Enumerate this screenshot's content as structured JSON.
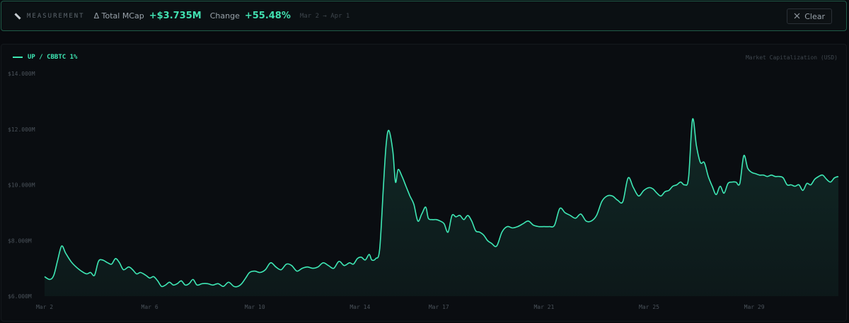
{
  "measurement": {
    "label": "MEASUREMENT",
    "icon": "ruler-icon",
    "delta_label": "Δ Total MCap",
    "delta_value": "+$3.735M",
    "change_label": "Change",
    "change_value": "+55.48%",
    "range": "Mar 2 → Apr 1",
    "clear_label": "Clear",
    "clear_icon": "close-icon"
  },
  "colors": {
    "accent": "#3ee8b5",
    "background": "#080a0e",
    "panel_border": "#1f5a47"
  },
  "chart_data": {
    "type": "area",
    "legend": "UP / CBBTC 1%",
    "ylabel": "Market Capitalization (USD)",
    "ylim": [
      6.0,
      14.0
    ],
    "y_ticks": [
      "$6.000M",
      "$8.000M",
      "$10.000M",
      "$12.000M",
      "$14.000M"
    ],
    "y_tick_values": [
      6,
      8,
      10,
      12,
      14
    ],
    "x_ticks": [
      "Mar 2",
      "Mar 6",
      "Mar 10",
      "Mar 14",
      "Mar 17",
      "Mar 21",
      "Mar 25",
      "Mar 29"
    ],
    "x_tick_days": [
      0,
      4,
      8,
      12,
      15,
      19,
      23,
      27
    ],
    "xlim_days": [
      0,
      30.2
    ],
    "grid": false,
    "series": [
      {
        "name": "UP / CBBTC 1%",
        "x_days": [
          0,
          0.2,
          0.35,
          0.5,
          0.65,
          0.8,
          1.0,
          1.2,
          1.4,
          1.6,
          1.75,
          1.9,
          2.05,
          2.2,
          2.4,
          2.55,
          2.7,
          2.85,
          3.0,
          3.2,
          3.35,
          3.5,
          3.65,
          3.85,
          4.0,
          4.15,
          4.3,
          4.45,
          4.6,
          4.75,
          4.9,
          5.05,
          5.2,
          5.35,
          5.5,
          5.65,
          5.8,
          6.0,
          6.2,
          6.4,
          6.6,
          6.8,
          7.0,
          7.2,
          7.35,
          7.5,
          7.65,
          7.8,
          8.0,
          8.2,
          8.4,
          8.6,
          8.8,
          9.0,
          9.2,
          9.4,
          9.6,
          9.8,
          10.0,
          10.2,
          10.4,
          10.6,
          10.8,
          11.0,
          11.2,
          11.4,
          11.6,
          11.75,
          11.9,
          12.05,
          12.2,
          12.35,
          12.45,
          12.6,
          12.75,
          12.9,
          13.0,
          13.1,
          13.25,
          13.35,
          13.45,
          13.6,
          13.75,
          13.9,
          14.05,
          14.2,
          14.35,
          14.5,
          14.6,
          14.75,
          14.9,
          15.05,
          15.2,
          15.35,
          15.5,
          15.65,
          15.8,
          15.95,
          16.1,
          16.25,
          16.4,
          16.55,
          16.7,
          16.85,
          17.0,
          17.2,
          17.4,
          17.6,
          17.8,
          18.0,
          18.2,
          18.4,
          18.6,
          18.8,
          19.0,
          19.2,
          19.4,
          19.6,
          19.8,
          20.0,
          20.2,
          20.4,
          20.6,
          20.8,
          21.0,
          21.2,
          21.4,
          21.6,
          21.8,
          22.0,
          22.2,
          22.4,
          22.6,
          22.8,
          23.0,
          23.15,
          23.3,
          23.45,
          23.6,
          23.75,
          23.9,
          24.05,
          24.2,
          24.35,
          24.5,
          24.65,
          24.8,
          24.95,
          25.1,
          25.25,
          25.4,
          25.55,
          25.7,
          25.85,
          26.0,
          26.15,
          26.3,
          26.45,
          26.6,
          26.75,
          26.9,
          27.05,
          27.2,
          27.35,
          27.5,
          27.65,
          27.8,
          27.95,
          28.1,
          28.25,
          28.4,
          28.55,
          28.7,
          28.85,
          29.0,
          29.15,
          29.3,
          29.45,
          29.6,
          29.75,
          29.9,
          30.05,
          30.2
        ],
        "values_musd": [
          6.7,
          6.6,
          6.75,
          7.3,
          7.8,
          7.55,
          7.25,
          7.05,
          6.9,
          6.8,
          6.85,
          6.75,
          7.25,
          7.3,
          7.2,
          7.15,
          7.35,
          7.2,
          6.95,
          7.05,
          6.95,
          6.8,
          6.85,
          6.75,
          6.65,
          6.7,
          6.55,
          6.35,
          6.4,
          6.5,
          6.4,
          6.45,
          6.55,
          6.4,
          6.45,
          6.6,
          6.4,
          6.45,
          6.45,
          6.4,
          6.45,
          6.35,
          6.5,
          6.35,
          6.35,
          6.45,
          6.65,
          6.85,
          6.9,
          6.85,
          6.95,
          7.2,
          7.05,
          6.95,
          7.15,
          7.1,
          6.9,
          7.0,
          7.05,
          7.0,
          7.05,
          7.2,
          7.1,
          7.0,
          7.25,
          7.1,
          7.2,
          7.15,
          7.35,
          7.4,
          7.3,
          7.5,
          7.3,
          7.35,
          7.7,
          10.1,
          11.5,
          11.95,
          11.2,
          10.1,
          10.55,
          10.3,
          9.95,
          9.6,
          9.3,
          8.7,
          8.95,
          9.2,
          8.8,
          8.75,
          8.75,
          8.7,
          8.6,
          8.3,
          8.9,
          8.85,
          8.9,
          8.75,
          8.9,
          8.7,
          8.35,
          8.3,
          8.2,
          8.0,
          7.9,
          7.8,
          8.3,
          8.5,
          8.45,
          8.5,
          8.6,
          8.7,
          8.55,
          8.5,
          8.5,
          8.5,
          8.55,
          9.15,
          9.0,
          8.9,
          8.8,
          8.95,
          8.7,
          8.7,
          8.9,
          9.4,
          9.6,
          9.6,
          9.45,
          9.4,
          10.25,
          9.9,
          9.6,
          9.8,
          9.9,
          9.85,
          9.7,
          9.6,
          9.75,
          9.8,
          9.95,
          10.0,
          10.1,
          10.0,
          10.25,
          12.35,
          11.4,
          10.8,
          10.8,
          10.3,
          9.95,
          9.65,
          9.95,
          9.7,
          10.05,
          10.1,
          10.1,
          10.05,
          11.05,
          10.6,
          10.45,
          10.4,
          10.35,
          10.35,
          10.3,
          10.35,
          10.3,
          10.3,
          10.25,
          10.0,
          10.0,
          9.95,
          10.0,
          9.8,
          10.05,
          10.0,
          10.2,
          10.3,
          10.35,
          10.2,
          10.1,
          10.25,
          10.3,
          10.35,
          10.45
        ]
      }
    ]
  }
}
